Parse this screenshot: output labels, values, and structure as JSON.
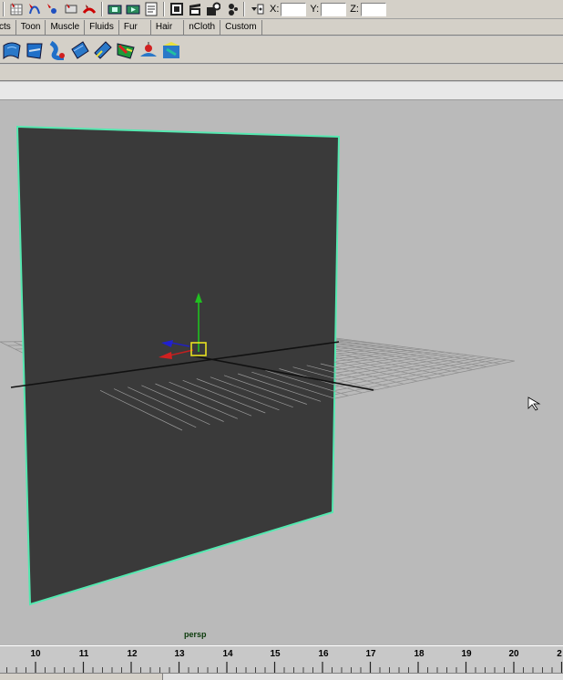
{
  "status_line": {
    "icons": [
      "magnet-grid-icon",
      "magnet-curve-icon",
      "magnet-point-icon",
      "magnet-view-icon",
      "magnet-surface-icon",
      "history-icon",
      "input-list-icon",
      "output-list-icon",
      "render-icon",
      "ipr-render-icon",
      "render-settings-icon",
      "hypershade-icon",
      "input-mode-icon"
    ],
    "x_label": "X:",
    "y_label": "Y:",
    "z_label": "Z:"
  },
  "shelf_tabs": [
    "cts",
    "Toon",
    "Muscle",
    "Fluids",
    "Fur",
    "Hair",
    "nCloth",
    "Custom"
  ],
  "shelf_icons": [
    "ncloth-create-icon",
    "ncloth-passive-icon",
    "ncloth-constraint-icon",
    "ncloth-wrap-icon",
    "ncloth-tear-icon",
    "ncloth-paint-icon",
    "ncloth-field-icon",
    "ncloth-cache-icon"
  ],
  "viewport": {
    "camera": "persp"
  },
  "time_slider": {
    "labels": [
      "10",
      "11",
      "12",
      "13",
      "14",
      "15",
      "16",
      "17",
      "18",
      "19",
      "20",
      "2"
    ]
  }
}
